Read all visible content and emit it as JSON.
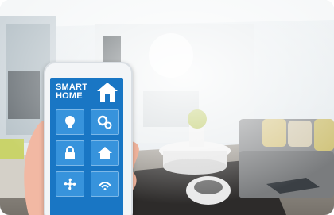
{
  "app": {
    "title_line1": "SMART",
    "title_line2": "HOME"
  },
  "tiles": [
    {
      "icon": "light-bulb-icon"
    },
    {
      "icon": "gears-icon"
    },
    {
      "icon": "lock-icon"
    },
    {
      "icon": "home-icon"
    },
    {
      "icon": "fan-icon"
    },
    {
      "icon": "wifi-icon"
    }
  ],
  "colors": {
    "screen_blue": "#1976c4",
    "tile_blue": "#3793dc"
  }
}
